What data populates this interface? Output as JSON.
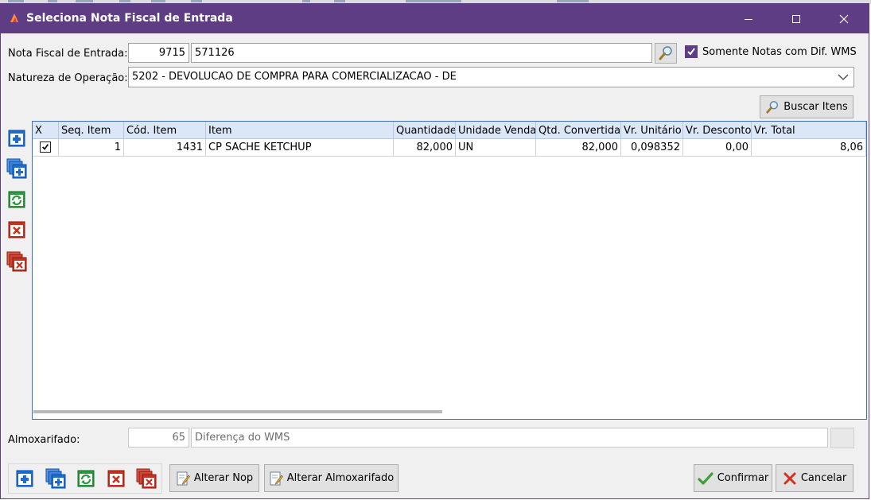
{
  "window": {
    "title": "Seleciona Nota Fiscal de Entrada",
    "minimize_icon": "minimize-icon",
    "maximize_icon": "maximize-icon",
    "close_icon": "close-icon"
  },
  "form": {
    "nf_label": "Nota Fiscal de Entrada:",
    "nf_code": "9715",
    "nf_number": "571126",
    "somente_label": "Somente Notas com Dif. WMS",
    "somente_checked": true,
    "natureza_label": "Natureza de Operação:",
    "natureza_value": "5202 - DEVOLUCAO DE  COMPRA PARA COMERCIALIZACAO - DE",
    "buscar_label": "Buscar Itens"
  },
  "grid": {
    "columns": [
      "X",
      "Seq. Item",
      "Cód. Item",
      "Item",
      "Quantidade",
      "Unidade Venda",
      "Qtd. Convertida",
      "Vr. Unitário",
      "Vr. Desconto",
      "Vr. Total"
    ],
    "rows": [
      {
        "checked": true,
        "seq": "1",
        "cod": "1431",
        "item": "CP SACHE KETCHUP",
        "quantidade": "82,000",
        "unidade": "UN",
        "qtd_convertida": "82,000",
        "vr_unitario": "0,098352",
        "vr_desconto": "0,00",
        "vr_total": "8,06"
      }
    ]
  },
  "almox": {
    "label": "Almoxarifado:",
    "code": "65",
    "description": "Diferença do WMS"
  },
  "footer": {
    "alterar_nop": "Alterar Nop",
    "alterar_almox": "Alterar Almoxarifado",
    "confirmar": "Confirmar",
    "cancelar": "Cancelar"
  },
  "colors": {
    "titlebar": "#5f3d85",
    "grid_border": "#3f6fb5",
    "grid_header": "#dbe7f7"
  }
}
